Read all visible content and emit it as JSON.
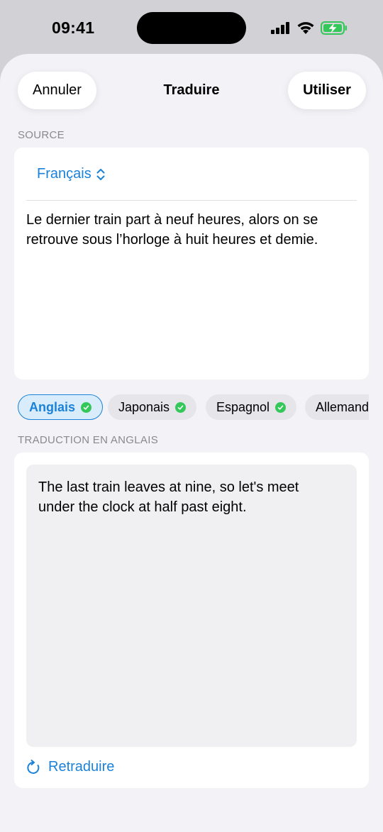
{
  "status": {
    "time": "09:41"
  },
  "nav": {
    "cancel_label": "Annuler",
    "title": "Traduire",
    "use_label": "Utiliser"
  },
  "source": {
    "section_label": "SOURCE",
    "language": "Français",
    "text": "Le dernier train part à neuf heures, alors on se retrouve sous l’horloge à huit heures et demie."
  },
  "target_languages": [
    {
      "label": "Anglais",
      "selected": true
    },
    {
      "label": "Japonais",
      "selected": false
    },
    {
      "label": "Espagnol",
      "selected": false
    },
    {
      "label": "Allemand",
      "selected": false
    }
  ],
  "translation": {
    "section_label": "TRADUCTION EN ANGLAIS",
    "text": "The last train leaves at nine, so let's meet under the clock at half past eight.",
    "retranslate_label": "Retraduire"
  },
  "colors": {
    "accent": "#1a82d9",
    "check": "#34c759",
    "battery": "#34c759"
  },
  "icons": [
    "signal-icon",
    "wifi-icon",
    "battery-charging-icon",
    "chevron-updown-icon",
    "checkmark-icon",
    "refresh-icon"
  ]
}
